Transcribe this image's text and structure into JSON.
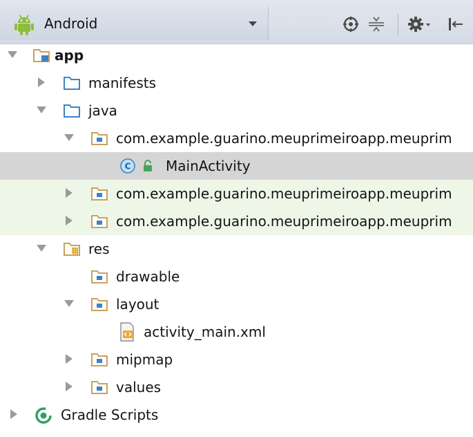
{
  "toolbar": {
    "view_label": "Android",
    "icons": [
      "android-icon",
      "dropdown-arrow-icon",
      "target-icon",
      "collapse-all-icon",
      "gear-icon",
      "hide-panel-icon"
    ]
  },
  "tree": {
    "app": "app",
    "manifests": "manifests",
    "java": "java",
    "pkg_main": "com.example.guarino.meuprimeiroapp.meuprim",
    "main_activity": "MainActivity",
    "pkg_android_test": "com.example.guarino.meuprimeiroapp.meuprim",
    "pkg_test": "com.example.guarino.meuprimeiroapp.meuprim",
    "res": "res",
    "drawable": "drawable",
    "layout": "layout",
    "activity_main_xml": "activity_main.xml",
    "mipmap": "mipmap",
    "values": "values",
    "gradle_scripts": "Gradle Scripts"
  },
  "colors": {
    "toolbar_bg": "#d5dbe5",
    "folder_blue": "#3a84c6",
    "package_brown": "#c9a25a",
    "selected_row": "#d5d5d5",
    "changed_row": "#eef6e8",
    "android_green": "#8dbe3b",
    "gradle_green": "#2f9f60"
  }
}
